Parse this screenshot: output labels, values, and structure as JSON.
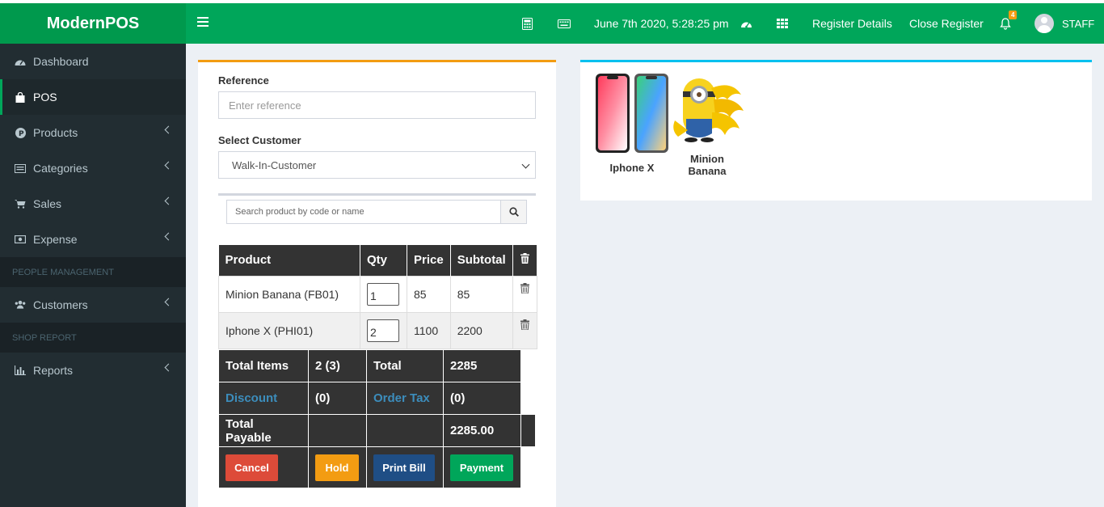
{
  "app": {
    "title": "ModernPOS"
  },
  "header": {
    "datetime": "June 7th 2020, 5:28:25 pm",
    "register_details": "Register Details",
    "close_register": "Close Register",
    "notification_count": "4",
    "user": "STAFF"
  },
  "sidebar": {
    "items": [
      {
        "label": "Dashboard",
        "icon": "dashboard-icon"
      },
      {
        "label": "POS",
        "icon": "shopping-bag-icon",
        "active": true
      },
      {
        "label": "Products",
        "icon": "product-icon"
      },
      {
        "label": "Categories",
        "icon": "list-icon"
      },
      {
        "label": "Sales",
        "icon": "cart-icon"
      },
      {
        "label": "Expense",
        "icon": "money-icon"
      }
    ],
    "section_people": "PEOPLE MANAGEMENT",
    "customers": "Customers",
    "section_shop": "SHOP REPORT",
    "reports": "Reports"
  },
  "form": {
    "reference_label": "Reference",
    "reference_placeholder": "Enter reference",
    "customer_label": "Select Customer",
    "customer_selected": "Walk-In-Customer",
    "search_placeholder": "Search product by code or name"
  },
  "cart": {
    "headers": {
      "product": "Product",
      "qty": "Qty",
      "price": "Price",
      "subtotal": "Subtotal"
    },
    "rows": [
      {
        "product": "Minion Banana (FB01)",
        "qty": "1",
        "price": "85",
        "subtotal": "85"
      },
      {
        "product": "Iphone X (PHI01)",
        "qty": "2",
        "price": "1100",
        "subtotal": "2200"
      }
    ]
  },
  "totals": {
    "total_items_label": "Total Items",
    "total_items_value": "2 (3)",
    "total_label": "Total",
    "total_value": "2285",
    "discount_label": "Discount",
    "discount_value": "(0)",
    "order_tax_label": "Order Tax",
    "order_tax_value": "(0)",
    "total_payable_label": "Total Payable",
    "total_payable_value": "2285.00"
  },
  "actions": {
    "cancel": "Cancel",
    "hold": "Hold",
    "print_bill": "Print Bill",
    "payment": "Payment"
  },
  "products": [
    {
      "name": "Iphone X"
    },
    {
      "name": "Minion Banana"
    }
  ],
  "colors": {
    "primary": "#00a65a",
    "logo_bg": "#00994d",
    "sidebar": "#222d32",
    "cancel": "#dd4b39",
    "hold": "#f39c12",
    "print": "#1f4e85",
    "payment": "#00a65a",
    "link": "#3c8dbc"
  }
}
